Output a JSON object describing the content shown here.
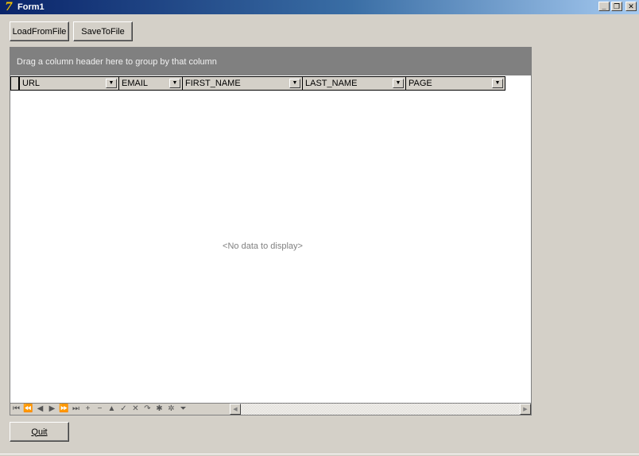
{
  "window": {
    "title": "Form1",
    "icon_glyph": "7",
    "minimize_glyph": "_",
    "restore_glyph": "❐",
    "close_glyph": "✕"
  },
  "toolbar": {
    "load_label": "LoadFromFile",
    "save_label": "SaveToFile"
  },
  "grid": {
    "group_by_hint": "Drag a column header here to group by that column",
    "columns": [
      "URL",
      "EMAIL",
      "FIRST_NAME",
      "LAST_NAME",
      "PAGE"
    ],
    "dropdown_glyph": "▼",
    "empty_text": "<No data to display>"
  },
  "navigator": {
    "buttons": [
      {
        "name": "first-record-icon",
        "glyph": "⏮"
      },
      {
        "name": "prior-page-icon",
        "glyph": "⏪"
      },
      {
        "name": "prior-record-icon",
        "glyph": "◀"
      },
      {
        "name": "next-record-icon",
        "glyph": "▶"
      },
      {
        "name": "next-page-icon",
        "glyph": "⏩"
      },
      {
        "name": "last-record-icon",
        "glyph": "⏭"
      },
      {
        "name": "insert-record-icon",
        "glyph": "+"
      },
      {
        "name": "delete-record-icon",
        "glyph": "−"
      },
      {
        "name": "edit-record-icon",
        "glyph": "▲"
      },
      {
        "name": "post-edit-icon",
        "glyph": "✓"
      },
      {
        "name": "cancel-edit-icon",
        "glyph": "✕"
      },
      {
        "name": "refresh-icon",
        "glyph": "↷"
      },
      {
        "name": "bookmark-icon",
        "glyph": "✱"
      },
      {
        "name": "goto-bookmark-icon",
        "glyph": "✲"
      },
      {
        "name": "filter-icon",
        "glyph": "⏷"
      }
    ],
    "scroll_left_glyph": "◀",
    "scroll_right_glyph": "▶"
  },
  "footer": {
    "quit_label": "Quit"
  }
}
